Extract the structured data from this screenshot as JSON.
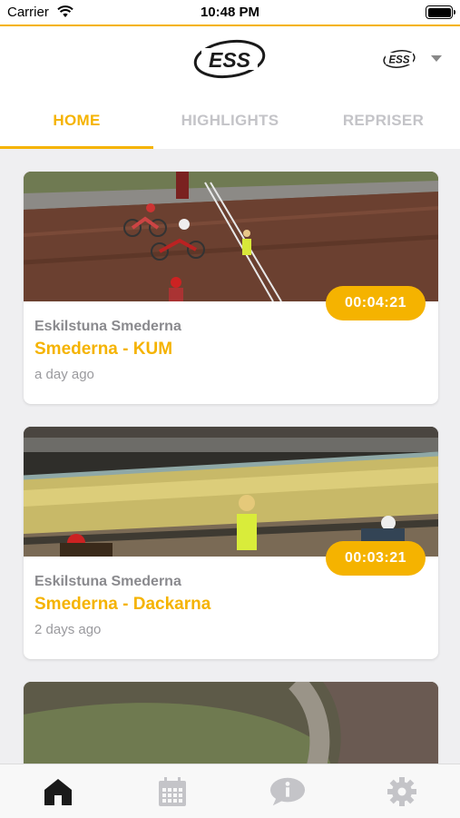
{
  "status_bar": {
    "carrier": "Carrier",
    "time": "10:48 PM"
  },
  "header": {
    "logo_text": "ESS",
    "team_logo_text": "ESS"
  },
  "tabs": [
    {
      "label": "HOME",
      "active": true
    },
    {
      "label": "HIGHLIGHTS",
      "active": false
    },
    {
      "label": "REPRISER",
      "active": false
    }
  ],
  "videos": [
    {
      "club": "Eskilstuna Smederna",
      "title": "Smederna - KUM",
      "time_ago": "a day ago",
      "duration": "00:04:21"
    },
    {
      "club": "Eskilstuna Smederna",
      "title": "Smederna - Dackarna",
      "time_ago": "2 days ago",
      "duration": "00:03:21"
    }
  ],
  "tab_bar": [
    {
      "icon": "home-icon",
      "active": true
    },
    {
      "icon": "calendar-icon",
      "active": false
    },
    {
      "icon": "info-icon",
      "active": false
    },
    {
      "icon": "gear-icon",
      "active": false
    }
  ],
  "colors": {
    "accent": "#f5b300",
    "inactive": "#c4c4c8",
    "background": "#efeff1"
  }
}
